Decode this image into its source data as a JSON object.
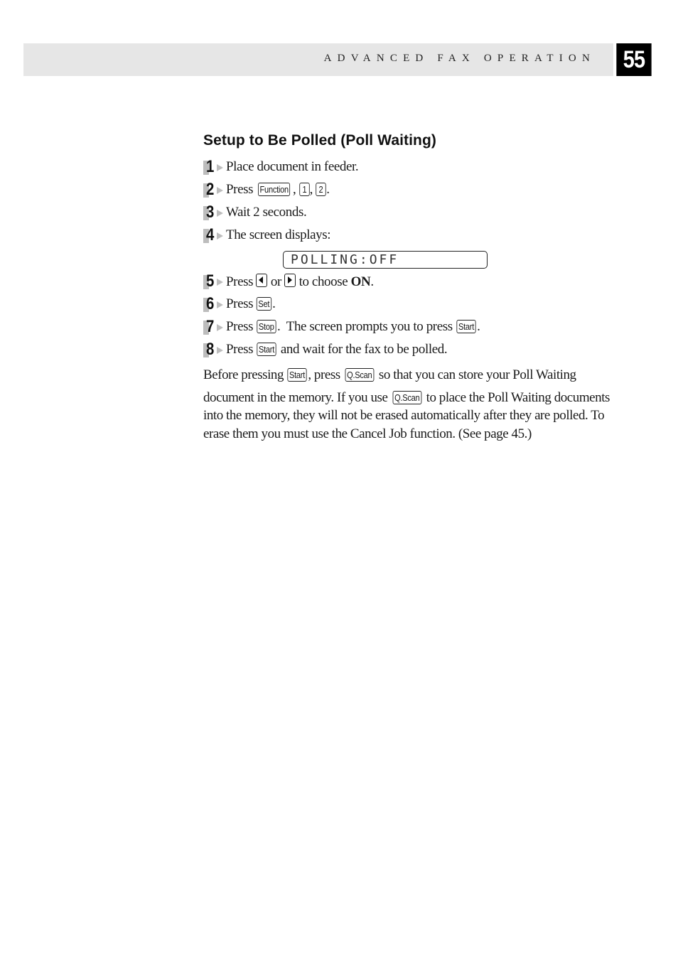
{
  "header": {
    "running_title": "ADVANCED FAX OPERATION",
    "page_number": "55"
  },
  "section": {
    "title": "Setup to Be Polled (Poll Waiting)"
  },
  "steps": [
    {
      "num": "1",
      "text": "Place document in feeder."
    },
    {
      "num": "2",
      "pre": "Press",
      "keys": [
        "Function",
        "1",
        "2"
      ],
      "sep": ", ",
      "post": "."
    },
    {
      "num": "3",
      "text": "Wait 2 seconds."
    },
    {
      "num": "4",
      "text": "The screen displays:"
    },
    {
      "num": "5",
      "pre": "Press",
      "mid": "or",
      "post_a": "to choose",
      "bold": "ON",
      "post": "."
    },
    {
      "num": "6",
      "pre": "Press",
      "key": "Set",
      "post": "."
    },
    {
      "num": "7",
      "pre": "Press",
      "key": "Stop",
      "mid": ".  The screen prompts you to press",
      "key2": "Start",
      "post": "."
    },
    {
      "num": "8",
      "pre": "Press",
      "key": "Start",
      "post": "and wait for the fax to be polled."
    }
  ],
  "lcd_display": "POLLING:OFF",
  "note": {
    "line1_a": "Before pressing",
    "key1": "Start",
    "line1_b": ", press",
    "key2": "Q.Scan",
    "line1_c": "so that you can store your Poll Waiting",
    "line2_a": "document in the memory. If you use",
    "key3": "Q.Scan",
    "line2_b": "to place the Poll Waiting documents",
    "line3": "into the memory, they will not be erased automatically after they are polled. To",
    "line4": "erase them you must use the Cancel Job function. (See page 45.)"
  }
}
